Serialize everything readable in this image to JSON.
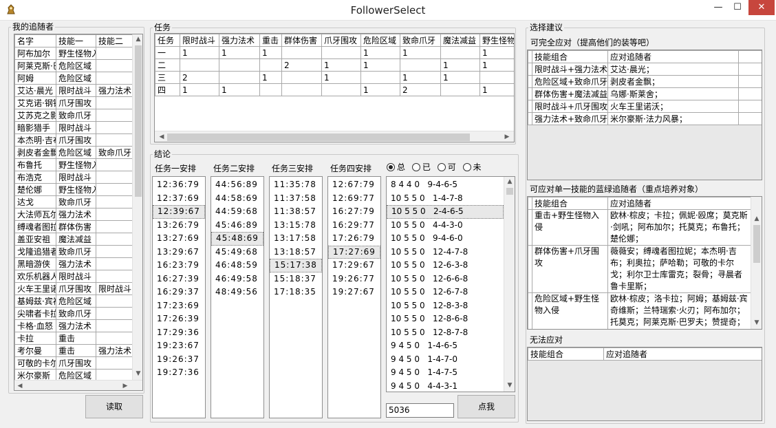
{
  "window": {
    "title": "FollowerSelect",
    "minimize": "—",
    "maximize": "☐",
    "close": "✕"
  },
  "followers": {
    "legend": "我的追随者",
    "columns": [
      "名字",
      "技能一",
      "技能二"
    ],
    "rows": [
      [
        "阿布加尔",
        "野生怪物入侵",
        ""
      ],
      [
        "阿莱克斯·巴罗夫",
        "危险区域",
        ""
      ],
      [
        "阿姆",
        "危险区域",
        ""
      ],
      [
        "艾达·晨光",
        "限时战斗",
        "强力法术"
      ],
      [
        "艾克诺·钢铁之拳",
        "爪牙围攻",
        ""
      ],
      [
        "艾苏克之影",
        "致命爪牙",
        ""
      ],
      [
        "暗影猎手",
        "限时战斗",
        ""
      ],
      [
        "本杰明·吉布",
        "爪牙围攻",
        ""
      ],
      [
        "剥皮者金飘",
        "危险区域",
        "致命爪牙"
      ],
      [
        "布鲁托",
        "野生怪物入侵",
        ""
      ],
      [
        "布浩克",
        "限时战斗",
        ""
      ],
      [
        "楚伦娜",
        "野生怪物入侵",
        ""
      ],
      [
        "达戈",
        "致命爪牙",
        ""
      ],
      [
        "大法师瓦尔",
        "强力法术",
        ""
      ],
      [
        "缚魂者图拉妮",
        "群体伤害",
        ""
      ],
      [
        "盖亚安祖",
        "魔法减益",
        ""
      ],
      [
        "戈隆追猎者",
        "致命爪牙",
        ""
      ],
      [
        "黑暗游侠",
        "强力法术",
        ""
      ],
      [
        "欢乐机器人",
        "限时战斗",
        ""
      ],
      [
        "火车王里诺",
        "爪牙围攻",
        "限时战斗"
      ],
      [
        "基姆兹·宾福",
        "危险区域",
        ""
      ],
      [
        "尖啸者卡拉",
        "致命爪牙",
        ""
      ],
      [
        "卡格·血怒",
        "强力法术",
        ""
      ],
      [
        "卡拉",
        "重击",
        ""
      ],
      [
        "考尔曼",
        "重击",
        "强力法术"
      ],
      [
        "可敬的卡尔",
        "爪牙围攻",
        ""
      ],
      [
        "米尔豪斯",
        "危险区域",
        ""
      ]
    ],
    "read_button": "读取"
  },
  "tasks": {
    "legend": "任务",
    "columns": [
      "任务",
      "限时战斗",
      "强力法术",
      "重击",
      "群体伤害",
      "爪牙围攻",
      "危险区域",
      "致命爪牙",
      "魔法减益",
      "野生怪物"
    ],
    "rows": [
      [
        "一",
        "1",
        "1",
        "1",
        "",
        "",
        "1",
        "1",
        "",
        "1"
      ],
      [
        "二",
        "",
        "",
        "",
        "2",
        "1",
        "1",
        "",
        "1",
        "1"
      ],
      [
        "三",
        "2",
        "",
        "1",
        "",
        "1",
        "",
        "1",
        "1",
        ""
      ],
      [
        "四",
        "1",
        "1",
        "",
        "",
        "",
        "1",
        "2",
        "",
        "1"
      ]
    ]
  },
  "results": {
    "legend": "结论",
    "headers": [
      "任务一安排",
      "任务二安排",
      "任务三安排",
      "任务四安排"
    ],
    "lists": [
      [
        "12:36:79",
        "12:37:69",
        "12:39:67",
        "13:26:79",
        "13:27:69",
        "13:29:67",
        "16:23:79",
        "16:27:39",
        "16:29:37",
        "17:23:69",
        "17:26:39",
        "17:29:36",
        "19:23:67",
        "19:26:37",
        "19:27:36"
      ],
      [
        "44:56:89",
        "44:58:69",
        "44:59:68",
        "45:46:89",
        "45:48:69",
        "45:49:68",
        "46:48:59",
        "46:49:58",
        "48:49:56"
      ],
      [
        "11:35:78",
        "11:37:58",
        "11:38:57",
        "13:15:78",
        "13:17:58",
        "13:18:57",
        "15:17:38",
        "15:18:37",
        "17:18:35"
      ],
      [
        "12:67:79",
        "12:69:77",
        "16:27:79",
        "16:29:77",
        "17:26:79",
        "17:27:69",
        "17:29:67",
        "19:26:77",
        "19:27:67"
      ]
    ],
    "selected": [
      2,
      4,
      6,
      5
    ],
    "radios": [
      "总",
      "已",
      "可",
      "未"
    ],
    "combos": [
      "8 4 4 0   9-4-6-5",
      "10 5 5 0   1-4-7-8",
      "10 5 5 0   2-4-6-5",
      "10 5 5 0   4-4-3-0",
      "10 5 5 0   9-4-6-0",
      "10 5 5 0   12-4-7-8",
      "10 5 5 0   12-6-3-8",
      "10 5 5 0   12-6-6-8",
      "10 5 5 0   12-6-7-8",
      "10 5 5 0   12-8-3-8",
      "10 5 5 0   12-8-6-8",
      "10 5 5 0   12-8-7-8",
      "9 4 5 0   1-4-6-5",
      "9 4 5 0   1-4-7-0",
      "9 4 5 0   1-4-7-5",
      "9 4 5 0   4-4-3-1"
    ],
    "count_value": "5036",
    "click_button": "点我"
  },
  "advice": {
    "legend": "选择建议",
    "full_label": "可完全应对（提高他们的装等吧）",
    "full_columns": [
      "技能组合",
      "应对追随者"
    ],
    "full_rows": [
      [
        "限时战斗+强力法术",
        "艾达·晨光；"
      ],
      [
        "危险区域+致命爪牙",
        "剥皮者金飘；"
      ],
      [
        "群体伤害+魔法减益",
        "乌娜·斯莱舍；"
      ],
      [
        "限时战斗+爪牙围攻",
        "火车王里诺沃；"
      ],
      [
        "强力法术+致命爪牙",
        "米尔豪斯·法力风暴；"
      ]
    ],
    "single_label": "可应对单一技能的蓝绿追随者（重点培养对象）",
    "single_columns": [
      "技能组合",
      "应对追随者"
    ],
    "single_rows": [
      [
        "重击+野生怪物入侵",
        "欧林·棕皮；卡拉；佩妮·殴席；莫克斯·剑吼；阿布加尔；托莫克；布鲁托；楚伦娜；"
      ],
      [
        "群体伤害+爪牙围攻",
        "薇薇安；缚魂者图拉妮；本杰明·吉布；利奥拉；萨哈勒；可敬的卡尔戈；利尔卫士库雷克；裂骨；寻晨者鲁卡里斯；"
      ],
      [
        "危险区域+野生怪物入侵",
        "欧林·棕皮；洛卡拉；阿姆；基姆兹·宾奇维斯；兰特瑞索·火刃；阿布加尔；托莫克；阿莱克斯·巴罗夫；赞提奇；布鲁托；楚伦娜；"
      ]
    ],
    "none_label": "无法应对",
    "none_columns": [
      "技能组合",
      "应对追随者"
    ]
  }
}
